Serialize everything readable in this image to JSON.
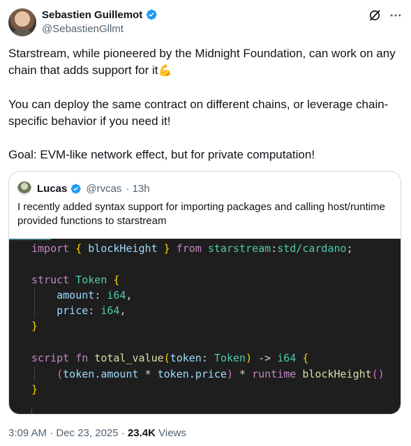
{
  "author": {
    "display_name": "Sebastien Guillemot",
    "handle": "@SebastienGllmt"
  },
  "tweet": {
    "paragraphs": [
      "Starstream, while pioneered by the Midnight Foundation, can work on any chain that adds support for it",
      "You can deploy the same contract on different chains, or leverage chain-specific behavior if you need it!",
      "Goal: EVM-like network effect, but for private computation!"
    ],
    "emoji": "💪"
  },
  "quote": {
    "display_name": "Lucas",
    "handle": "@rvcas",
    "time": "· 13h",
    "text": "I recently added syntax support for importing packages and calling host/runtime provided functions to starstream"
  },
  "code": {
    "line1": {
      "kw": "import",
      "b1": "{",
      "id": "blockHeight",
      "b2": "}",
      "from": "from",
      "mod": "starstream",
      "colon": ":",
      "path": "std/cardano",
      "semi": ";"
    },
    "line3": {
      "kw": "struct",
      "name": "Token",
      "brace": "{"
    },
    "line4": {
      "field": "amount",
      "colon": ":",
      "type": "i64",
      "comma": ","
    },
    "line5": {
      "field": "price",
      "colon": ":",
      "type": "i64",
      "comma": ","
    },
    "line6": {
      "brace": "}"
    },
    "line8": {
      "kw1": "script",
      "kw2": "fn",
      "fname": "total_value",
      "p1": "(",
      "param": "token",
      "colon": ":",
      "ptype": "Token",
      "p2": ")",
      "arrow": "->",
      "rtype": "i64",
      "brace": "{"
    },
    "line9": {
      "p1": "(",
      "a": "token",
      "dot1": ".",
      "b": "amount",
      "star1": "*",
      "c": "token",
      "dot2": ".",
      "d": "price",
      "p2": ")",
      "star2": "*",
      "kw": "runtime",
      "call": "blockHeight",
      "parens": "()"
    },
    "line10": {
      "brace": "}"
    }
  },
  "footer": {
    "timestamp": "3:09 AM · Dec 23, 2025 · ",
    "views_count": "23.4K",
    "views_label": " Views"
  },
  "colors": {
    "verified": "#1d9bf0",
    "text": "#0f1419",
    "secondary": "#536471",
    "code_bg": "#1e1e1e"
  }
}
